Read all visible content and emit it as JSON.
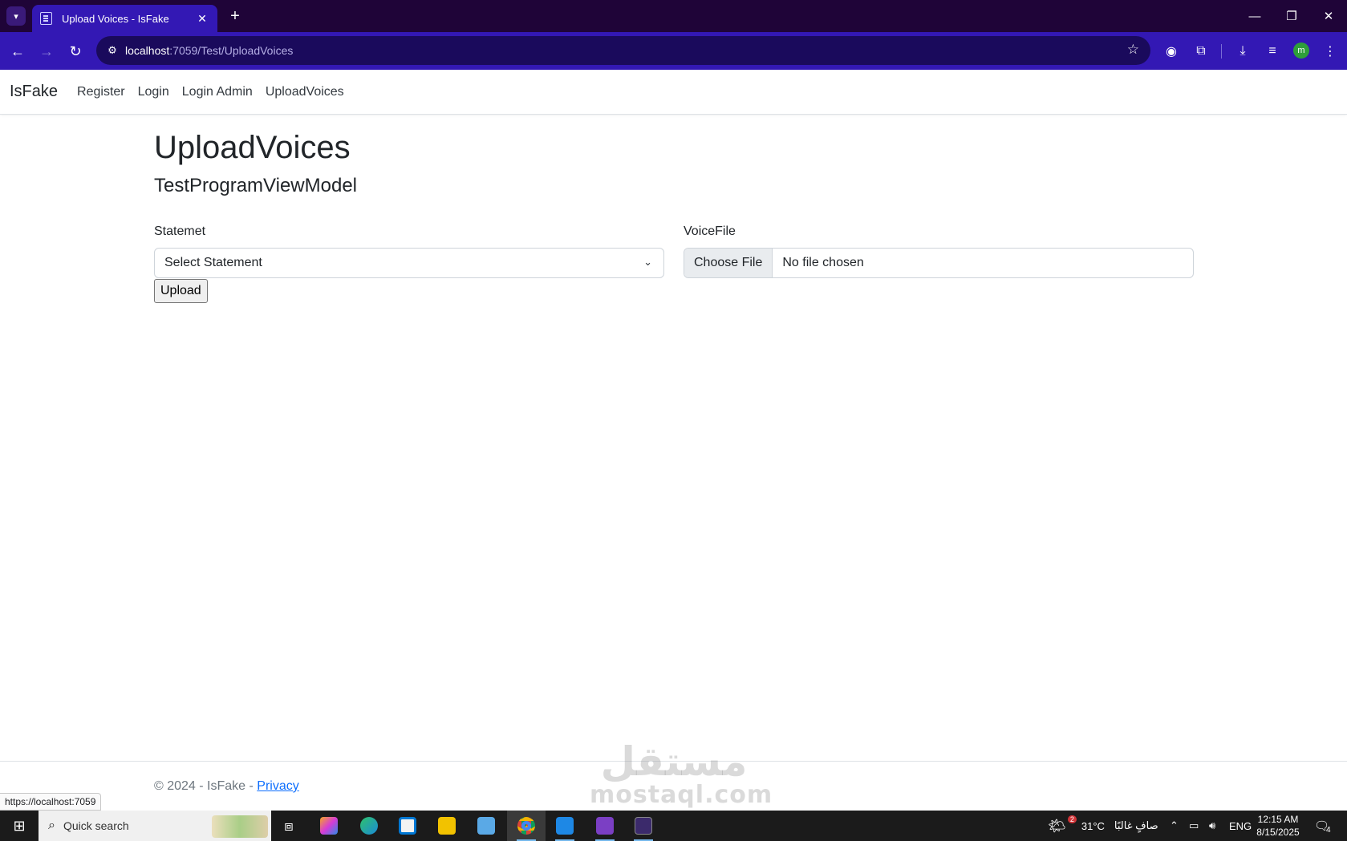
{
  "browser": {
    "tab_title": "Upload Voices - IsFake",
    "new_tab": "+",
    "url_host": "localhost",
    "url_path": ":7059/Test/UploadVoices",
    "status_url": "https://localhost:7059"
  },
  "navbar": {
    "brand": "IsFake",
    "links": [
      "Register",
      "Login",
      "Login Admin",
      "UploadVoices"
    ]
  },
  "page": {
    "title": "UploadVoices",
    "subtitle": "TestProgramViewModel",
    "statement_label": "Statemet",
    "statement_selected": "Select Statement",
    "voice_label": "VoiceFile",
    "choose_file": "Choose File",
    "no_file": "No file chosen",
    "upload_button": "Upload"
  },
  "footer": {
    "text": "© 2024 - IsFake - ",
    "privacy": "Privacy"
  },
  "watermark": {
    "arabic": "مستقل",
    "latin": "mostaql.com"
  },
  "taskbar": {
    "search_placeholder": "Quick search",
    "temperature": "31°C",
    "weather_text": "صافٍ غالبًا",
    "weather_badge": "2",
    "language": "ENG",
    "time": "12:15 AM",
    "date": "8/15/2025",
    "notifications": "4"
  }
}
